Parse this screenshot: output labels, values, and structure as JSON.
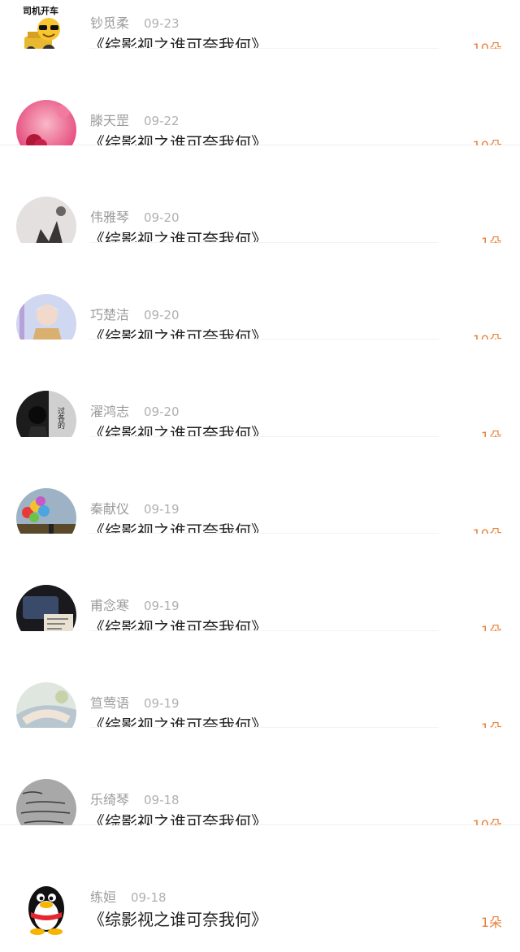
{
  "items": [
    {
      "name": "钞觅柔",
      "date": "09-23",
      "title": "《综影视之谁可奈我何》",
      "amount": "10朵",
      "avatar_text": "司机开车"
    },
    {
      "name": "滕天罡",
      "date": "09-22",
      "title": "《综影视之谁可奈我何》",
      "amount": "10朵"
    },
    {
      "name": "伟雅琴",
      "date": "09-20",
      "title": "《综影视之谁可奈我何》",
      "amount": "1朵"
    },
    {
      "name": "巧楚洁",
      "date": "09-20",
      "title": "《综影视之谁可奈我何》",
      "amount": "10朵"
    },
    {
      "name": "濯鸿志",
      "date": "09-20",
      "title": "《综影视之谁可奈我何》",
      "amount": "1朵",
      "avatar_text": "过各的"
    },
    {
      "name": "秦献仪",
      "date": "09-19",
      "title": "《综影视之谁可奈我何》",
      "amount": "10朵"
    },
    {
      "name": "甫念寒",
      "date": "09-19",
      "title": "《综影视之谁可奈我何》",
      "amount": "1朵"
    },
    {
      "name": "笪莺语",
      "date": "09-19",
      "title": "《综影视之谁可奈我何》",
      "amount": "1朵"
    },
    {
      "name": "乐绮琴",
      "date": "09-18",
      "title": "《综影视之谁可奈我何》",
      "amount": "10朵"
    },
    {
      "name": "练姮",
      "date": "09-18",
      "title": "《综影视之谁可奈我何》",
      "amount": "1朵"
    }
  ],
  "colors": {
    "amount": "#e8813b",
    "name": "#9b9b9b",
    "title": "#222222"
  }
}
